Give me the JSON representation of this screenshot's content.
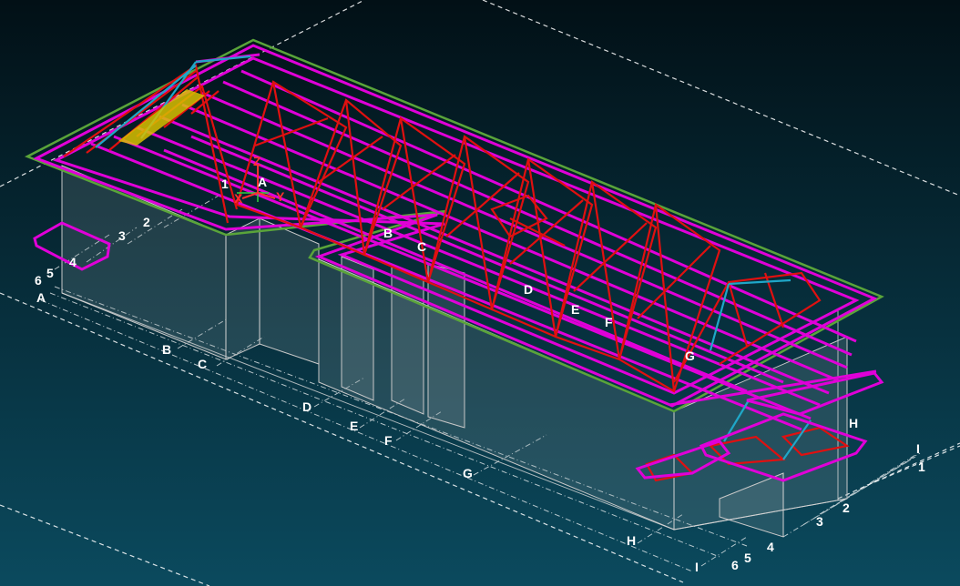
{
  "viewport": {
    "background_top": "#021016",
    "background_bottom": "#0b4a5e",
    "colors": {
      "purlin": "#e000d8",
      "truss": "#e01010",
      "brace": "#1fa7c8",
      "edge": "#5aa43a",
      "wall": "#c8c8c8",
      "guide": "#ffffff",
      "highlight": "#d8c000"
    }
  },
  "ucs": {
    "z_label": "Z",
    "x_label": "X",
    "y_label": "Y",
    "colors": {
      "z": "#ff3030",
      "x": "#ff3030",
      "y": "#ff3030",
      "origin": "#30d040"
    }
  },
  "grid_labels": {
    "origin_number": "1",
    "origin_letter": "A",
    "left_numbers": [
      "2",
      "3",
      "4",
      "5",
      "6"
    ],
    "front_letters": [
      "A",
      "B",
      "C",
      "D",
      "E",
      "F",
      "G",
      "H",
      "I"
    ],
    "roof_letters": [
      "B",
      "C",
      "D",
      "E",
      "F",
      "G",
      "H"
    ],
    "right_letter": "I",
    "right_numbers": [
      "1",
      "2",
      "3",
      "4",
      "5",
      "6"
    ]
  }
}
